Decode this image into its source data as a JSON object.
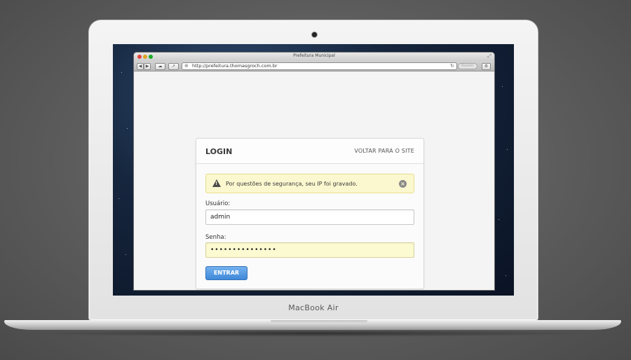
{
  "device": {
    "brand_label": "MacBook Air"
  },
  "browser": {
    "window_title": "Prefeitura Municipal",
    "url": "http://prefeitura.thomasgroch.com.br",
    "reader_label": "Reader",
    "nav_back_label": "◀",
    "nav_forward_label": "▶"
  },
  "login": {
    "title": "LOGIN",
    "back_link": "VOLTAR PARA O SITE",
    "alert_text": "Por questões de segurança, seu IP foi gravado.",
    "alert_icon": "warning-icon",
    "username_label": "Usuário:",
    "username_value": "admin",
    "password_label": "Senha:",
    "password_value": "•••••••••••••••",
    "submit_label": "ENTRAR",
    "colors": {
      "alert_bg": "#fbf7cf",
      "password_bg": "#fcfad0",
      "button": "#4a90e2"
    }
  }
}
